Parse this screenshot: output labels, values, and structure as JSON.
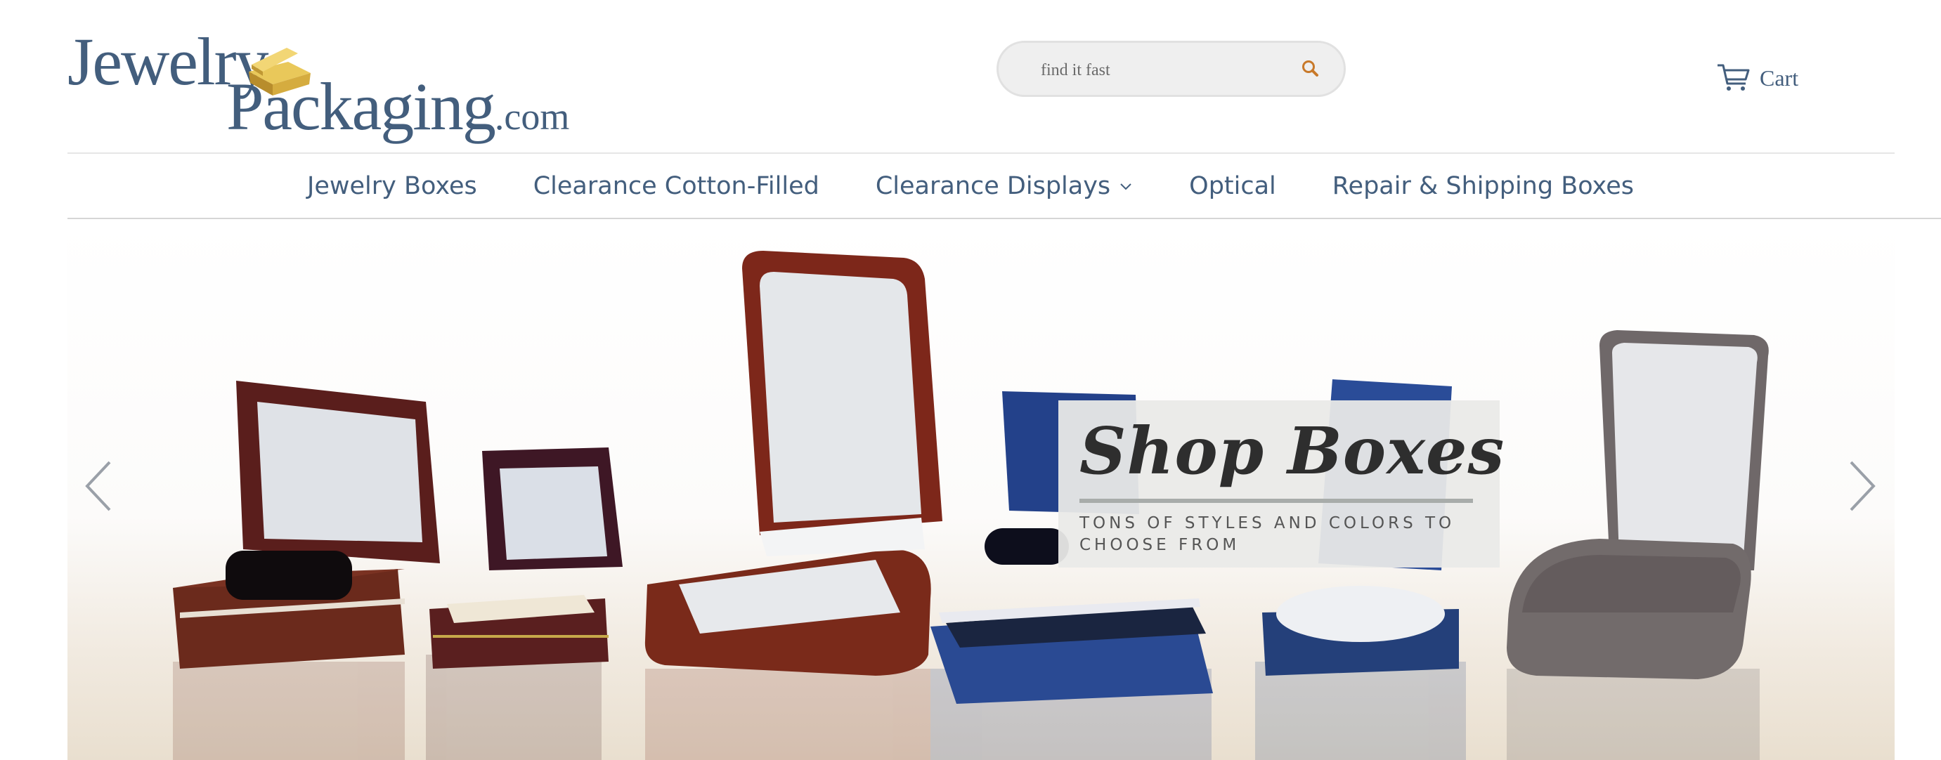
{
  "header": {
    "logo": {
      "line1": "Jewelry",
      "line2": "Packaging",
      "line2_suffix": ".com"
    },
    "search": {
      "placeholder": "find it fast",
      "icon": "search-icon"
    },
    "cart": {
      "label": "Cart",
      "icon": "cart-icon"
    }
  },
  "nav": {
    "items": [
      {
        "label": "Jewelry Boxes"
      },
      {
        "label": "Clearance Cotton-Filled"
      },
      {
        "label": "Clearance Displays",
        "icon": "chevron-down-icon"
      },
      {
        "label": "Optical"
      },
      {
        "label": "Repair & Shipping Boxes"
      }
    ]
  },
  "hero": {
    "title": "Shop Boxes",
    "subtitle": "TONS OF STYLES AND COLORS TO CHOOSE FROM",
    "prev_icon": "chevron-left-icon",
    "next_icon": "chevron-right-icon"
  },
  "colors": {
    "brand": "#435e7d",
    "accent": "#c8792a",
    "search_bg": "#efefef"
  }
}
